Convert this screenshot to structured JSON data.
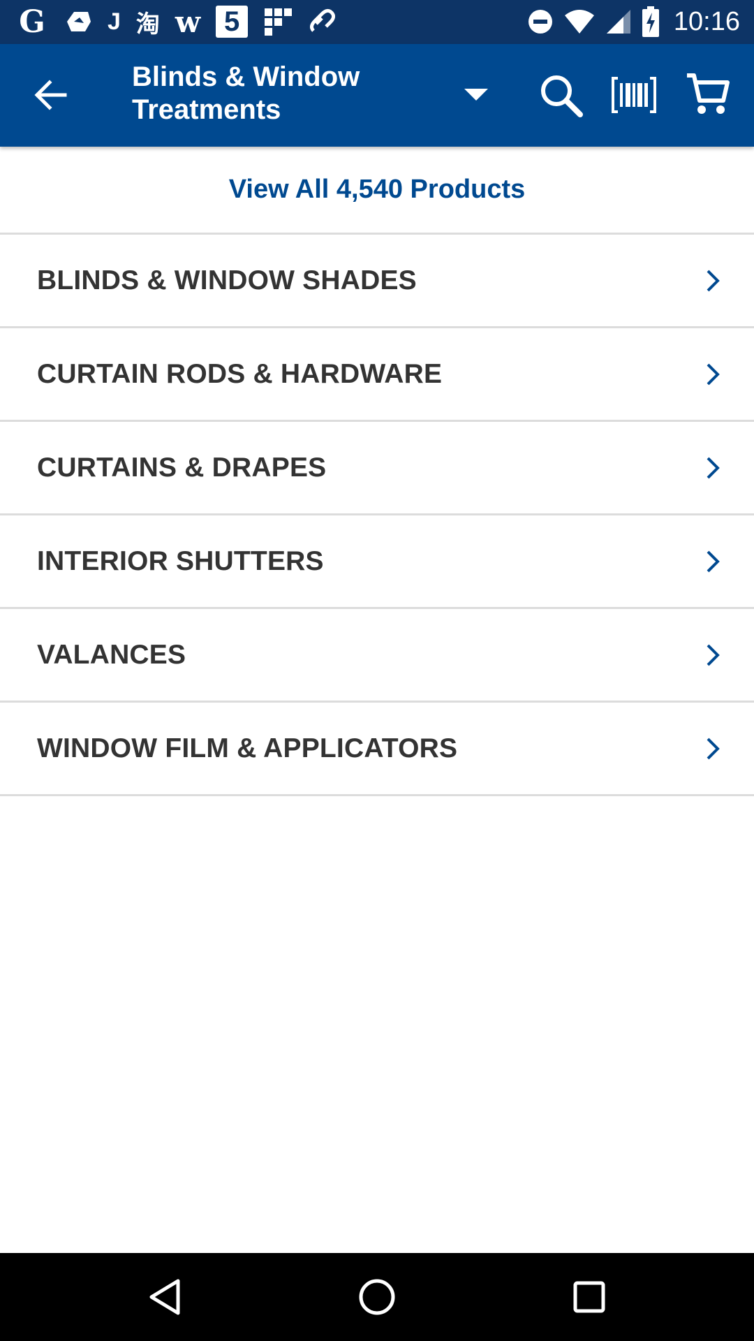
{
  "status_bar": {
    "time": "10:16",
    "left_icons": [
      "google-icon",
      "cloud-drive-icon",
      "j-app-icon",
      "taobao-icon",
      "w-app-icon",
      "five-app-icon",
      "grid-app-icon",
      "link-app-icon"
    ],
    "right_icons": [
      "do-not-disturb-icon",
      "wifi-icon",
      "cell-signal-icon",
      "battery-charging-icon"
    ],
    "g_letter": "G",
    "j_letter": "J",
    "taobao_char": "淘",
    "w_letter": "w",
    "five_number": "5"
  },
  "app_bar": {
    "title": "Blinds & Window Treatments",
    "back_icon": "arrow-left-icon",
    "dropdown_icon": "caret-down-icon",
    "search_icon": "search-icon",
    "barcode_icon": "barcode-icon",
    "cart_icon": "cart-icon",
    "background_color": "#004990"
  },
  "view_all": {
    "label": "View All 4,540 Products",
    "color": "#004990"
  },
  "categories": [
    {
      "label": "BLINDS & WINDOW SHADES"
    },
    {
      "label": "CURTAIN RODS & HARDWARE"
    },
    {
      "label": "CURTAINS & DRAPES"
    },
    {
      "label": "INTERIOR SHUTTERS"
    },
    {
      "label": "VALANCES"
    },
    {
      "label": "WINDOW FILM & APPLICATORS"
    }
  ],
  "nav_bar": {
    "buttons": [
      "back-triangle-icon",
      "home-circle-icon",
      "recents-square-icon"
    ]
  }
}
